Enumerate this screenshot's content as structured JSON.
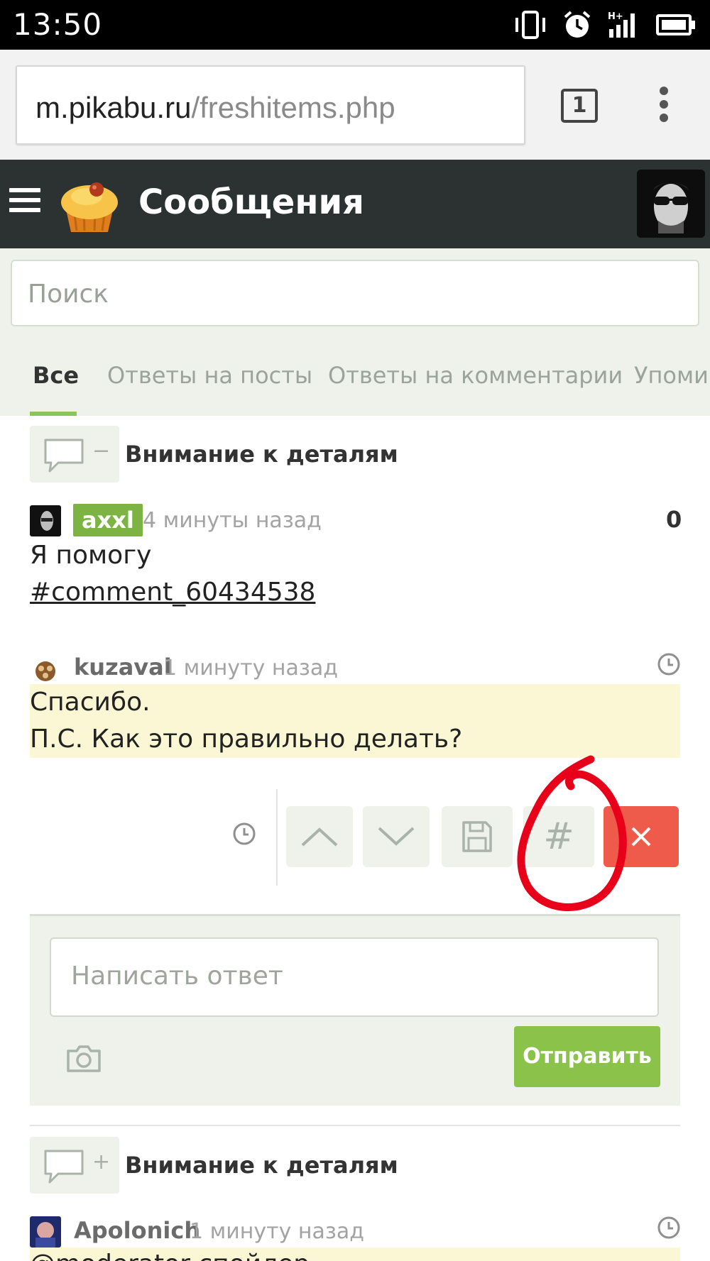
{
  "status_bar": {
    "time": "13:50",
    "icons": [
      "vibrate-icon",
      "alarm-icon",
      "signal-hplus-icon",
      "battery-icon"
    ]
  },
  "browser": {
    "url_host": "m.pikabu.ru",
    "url_path": "/freshitems.php",
    "tab_count": "1",
    "menu_icon": "kebab-menu-icon"
  },
  "header": {
    "title": "Сообщения",
    "logo": "pikabu-cupcake-logo",
    "menu_icon": "hamburger-icon"
  },
  "search": {
    "placeholder": "Поиск"
  },
  "tabs": [
    {
      "label": "Все",
      "active": true
    },
    {
      "label": "Ответы на посты",
      "active": false
    },
    {
      "label": "Ответы на комментарии",
      "active": false
    },
    {
      "label": "Упоми",
      "active": false
    }
  ],
  "threads": [
    {
      "title": "Внимание к деталям",
      "toggle": "−",
      "comments": [
        {
          "user": "axxl",
          "time": "4 минуты назад",
          "rating": "0",
          "text_line1": "Я помогу",
          "text_line2": "#comment_60434538"
        },
        {
          "user": "kuzaval",
          "time": "1 минуту назад",
          "text_line1": "Спасибо.",
          "text_line2": "П.С. Как это правильно делать?"
        }
      ]
    },
    {
      "title": "Внимание к деталям",
      "toggle": "+",
      "comments": [
        {
          "user": "Apolonich",
          "time": "1 минуту назад",
          "text_line1": "@moderator спойлер"
        }
      ]
    }
  ],
  "actions": {
    "up_icon": "chevron-up-icon",
    "down_icon": "chevron-down-icon",
    "save_icon": "floppy-disk-icon",
    "hash_label": "#",
    "close_icon": "close-icon"
  },
  "reply": {
    "placeholder": "Написать ответ",
    "send_label": "Отправить",
    "camera_icon": "camera-icon"
  },
  "colors": {
    "header_bg": "#2c3131",
    "accent_green": "#8bc34a",
    "delete_red": "#ef5b4b",
    "highlight_yellow": "#fbf6d3",
    "annotation_red": "#e8001a"
  }
}
